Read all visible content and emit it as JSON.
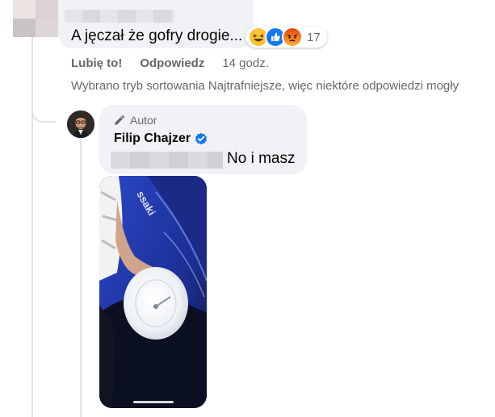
{
  "comment": {
    "text": "A jęczał że gofry drogie...",
    "reactions": {
      "count": "17",
      "icons": [
        "haha-icon",
        "like-icon",
        "angry-icon"
      ]
    }
  },
  "actions": {
    "like": "Lubię to!",
    "reply": "Odpowiedz",
    "time": "14 godz."
  },
  "notice": "Wybrano tryb sortowania Najtrafniejsze, więc niektóre odpowiedzi mogły",
  "reply": {
    "badge": "Autor",
    "author": "Filip Chajzer",
    "text": "No i masz",
    "media_text": "ssaki"
  },
  "colors": {
    "bubble": "#f0f2f5",
    "secondary_text": "#65676b",
    "verified": "#1877f2",
    "thread_line": "#dfe1e5"
  }
}
